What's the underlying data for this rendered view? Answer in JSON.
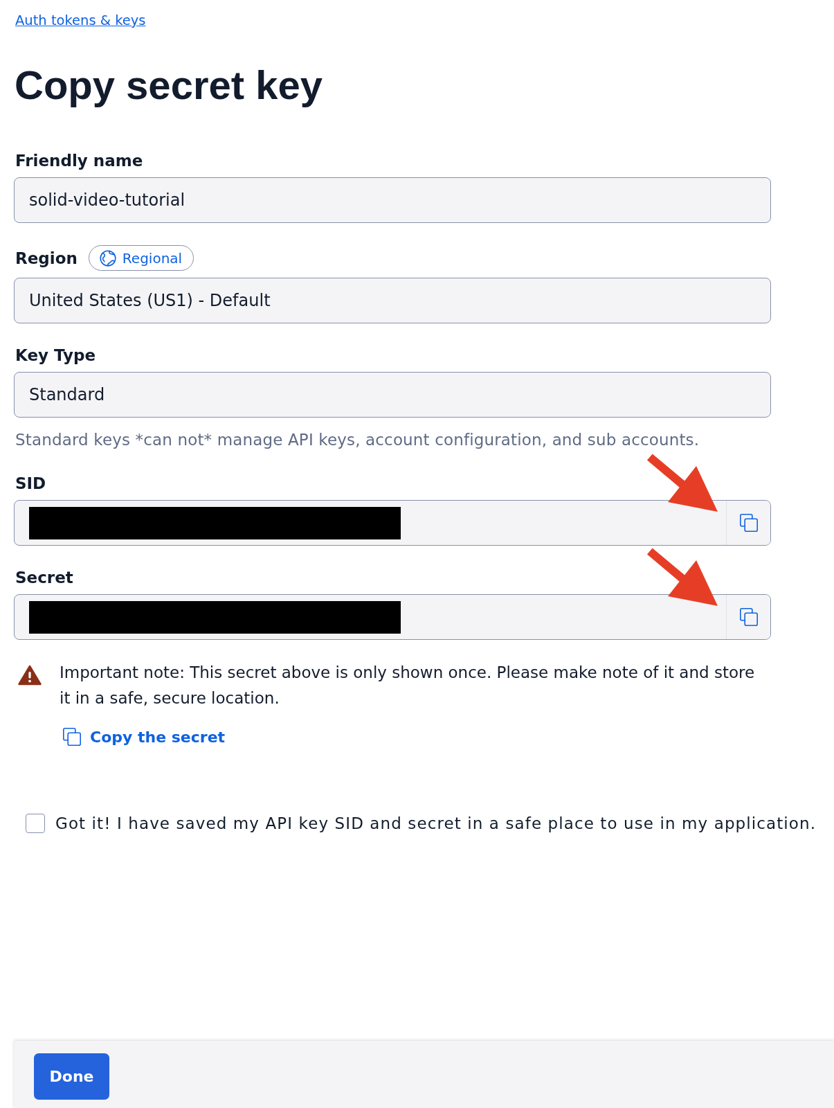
{
  "breadcrumb": {
    "link": "Auth tokens & keys"
  },
  "heading": "Copy secret key",
  "fields": [
    {
      "kind": "text",
      "label": "Friendly name",
      "value": "solid-video-tutorial"
    },
    {
      "kind": "text",
      "label": "Region",
      "badge": "Regional",
      "value": "United States (US1) - Default"
    },
    {
      "kind": "text",
      "label": "Key Type",
      "value": "Standard",
      "help": "Standard keys *can not* manage API keys, account configuration, and sub accounts."
    },
    {
      "kind": "secret",
      "label": "SID",
      "annotation_arrow": true
    },
    {
      "kind": "secret",
      "label": "Secret",
      "annotation_arrow": true
    }
  ],
  "note": {
    "text": "Important note: This secret above is only shown once. Please make note of it and store it in a safe, secure location.",
    "action": "Copy the secret"
  },
  "confirmation": {
    "label": "Got it! I have saved my API key SID and secret in a safe place to use in my application.",
    "checked": false
  },
  "footer": {
    "button": "Done"
  }
}
